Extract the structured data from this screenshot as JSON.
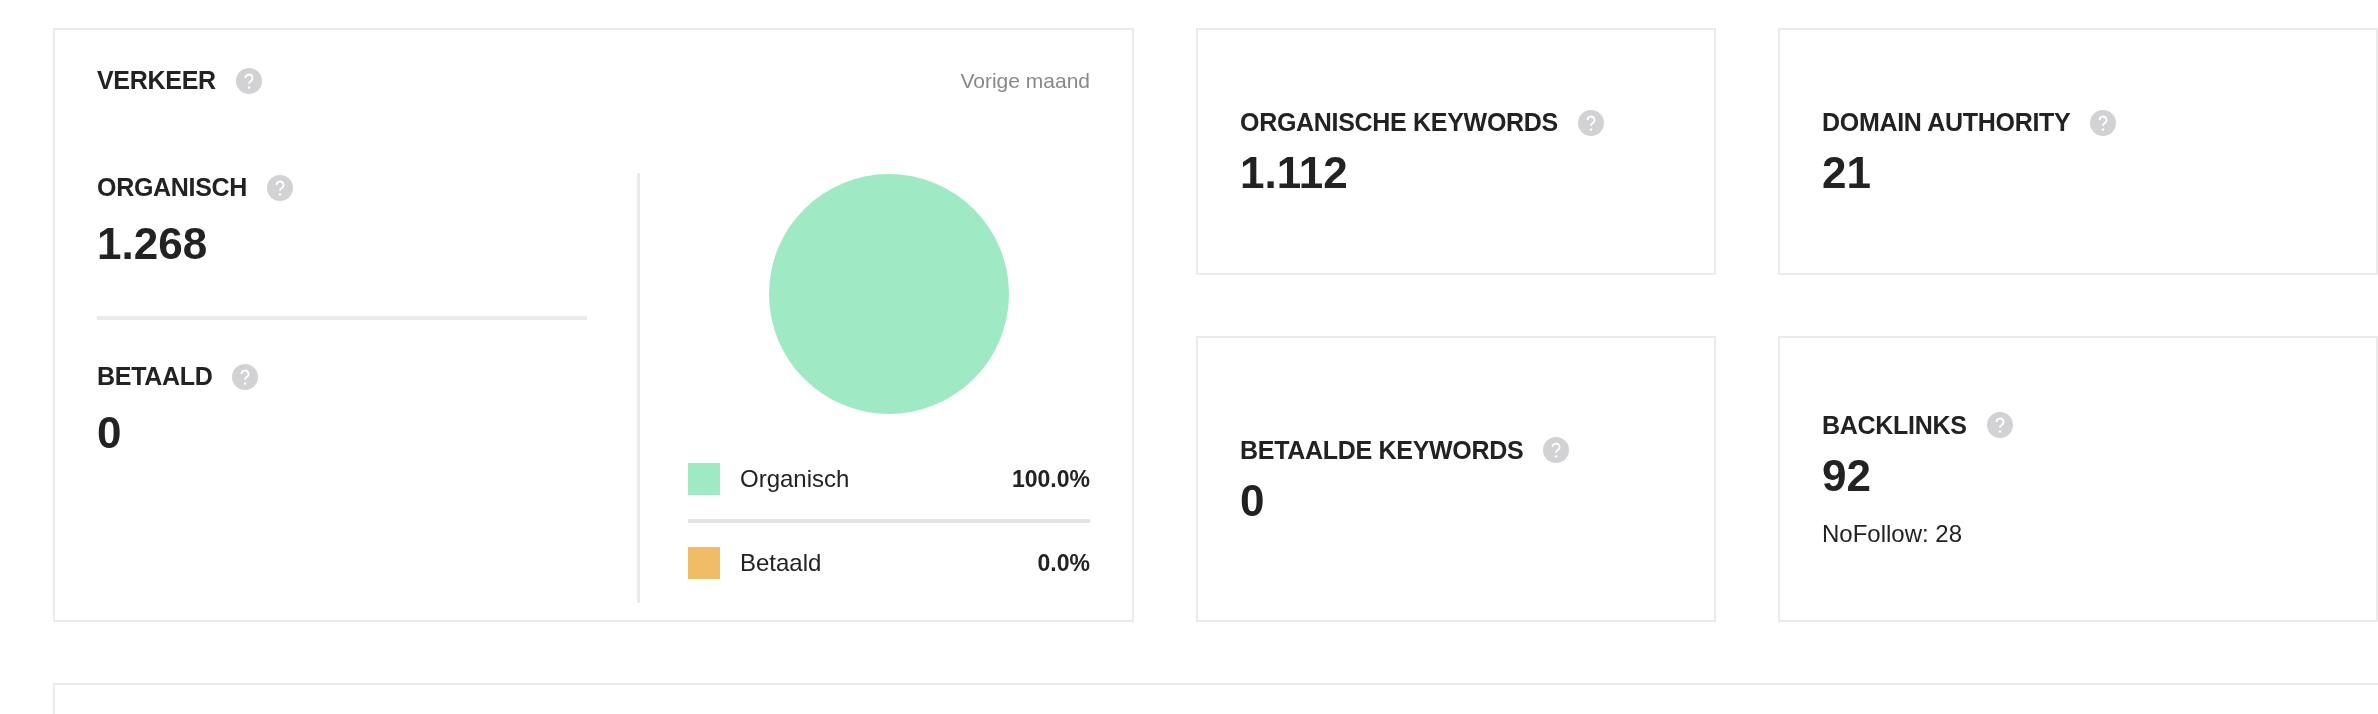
{
  "traffic": {
    "title": "VERKEER",
    "period": "Vorige maand",
    "metrics": [
      {
        "label": "ORGANISCH",
        "value": "1.268"
      },
      {
        "label": "BETAALD",
        "value": "0"
      }
    ],
    "chart_data": {
      "type": "pie",
      "categories": [
        "Organisch",
        "Betaald"
      ],
      "values": [
        100,
        0
      ]
    },
    "legend": [
      {
        "color": "#9fe9c5",
        "percent": "100.0%"
      },
      {
        "color": "#f0bd66",
        "percent": "0.0%"
      }
    ]
  },
  "stats": [
    {
      "label": "ORGANISCHE KEYWORDS",
      "value": "1.112"
    },
    {
      "label": "BETAALDE KEYWORDS",
      "value": "0"
    },
    {
      "label": "DOMAIN AUTHORITY",
      "value": "21"
    },
    {
      "label": "BACKLINKS",
      "value": "92",
      "note": "NoFollow: 28"
    }
  ]
}
